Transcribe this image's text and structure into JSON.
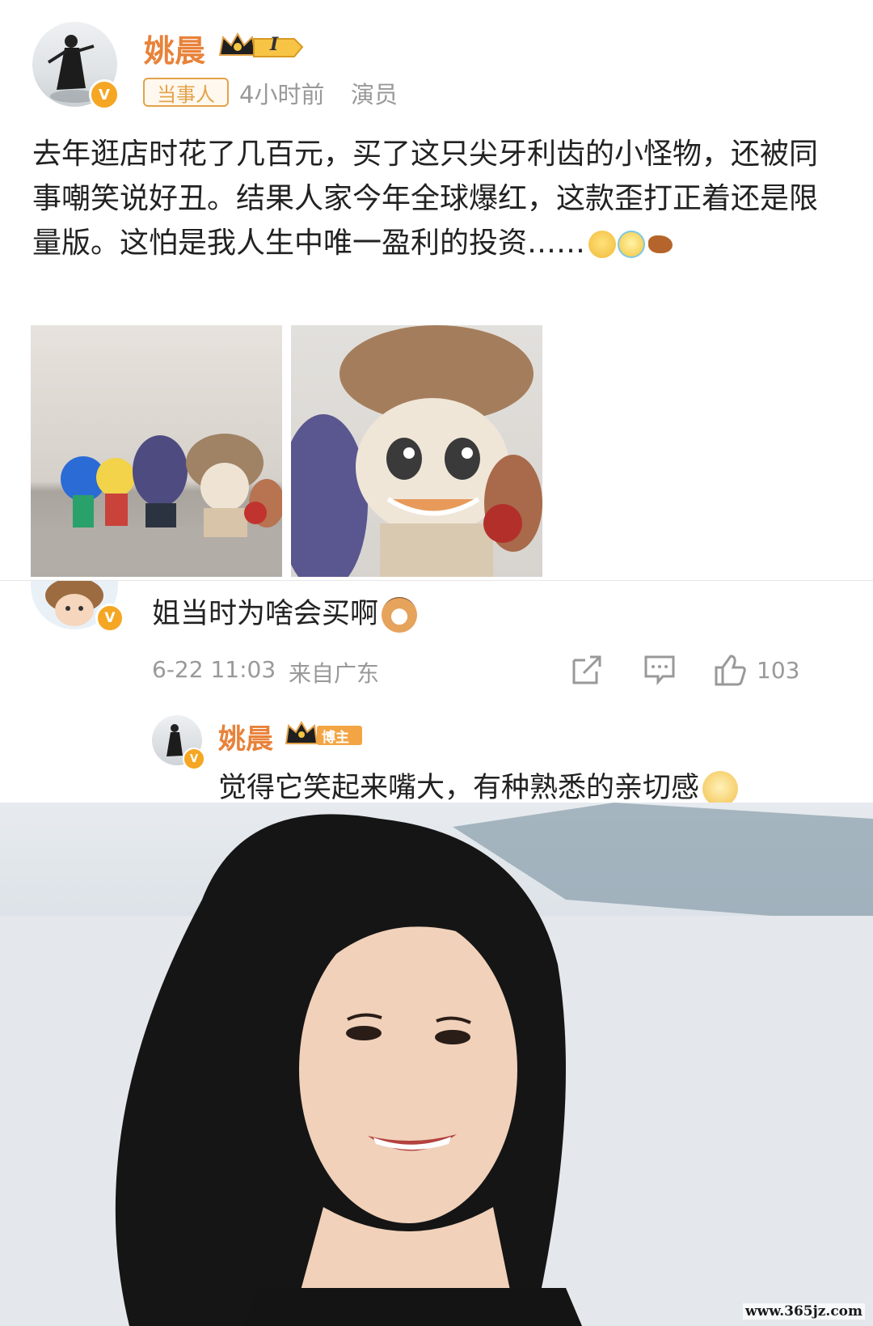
{
  "post": {
    "author": "姚晨",
    "level": "I",
    "tag": "当事人",
    "time": "4小时前",
    "role": "演员",
    "verified_mark": "V",
    "text": "去年逛店时花了几百元，买了这只尖牙利齿的小怪物，还被同事嘲笑说好丑。结果人家今年全球爆红，这款歪打正着还是限量版。这怕是我人生中唯一盈利的投资……"
  },
  "comment": {
    "text": "姐当时为啥会买啊",
    "date": "6-22 11:03",
    "source": "来自广东",
    "likes": "103"
  },
  "reply": {
    "author": "姚晨",
    "badge": "博主",
    "text": "觉得它笑起来嘴大，有种熟悉的亲切感"
  },
  "watermark": "www.365jz.com",
  "colors": {
    "name": "#e8823a",
    "tag": "#e3a24a",
    "meta": "#999999"
  },
  "icons": [
    "crown-icon",
    "verified-icon",
    "share-icon",
    "comment-icon",
    "like-icon",
    "doge-emoji",
    "laugh-cry-emoji",
    "drumstick-emoji",
    "cat-emoji"
  ]
}
